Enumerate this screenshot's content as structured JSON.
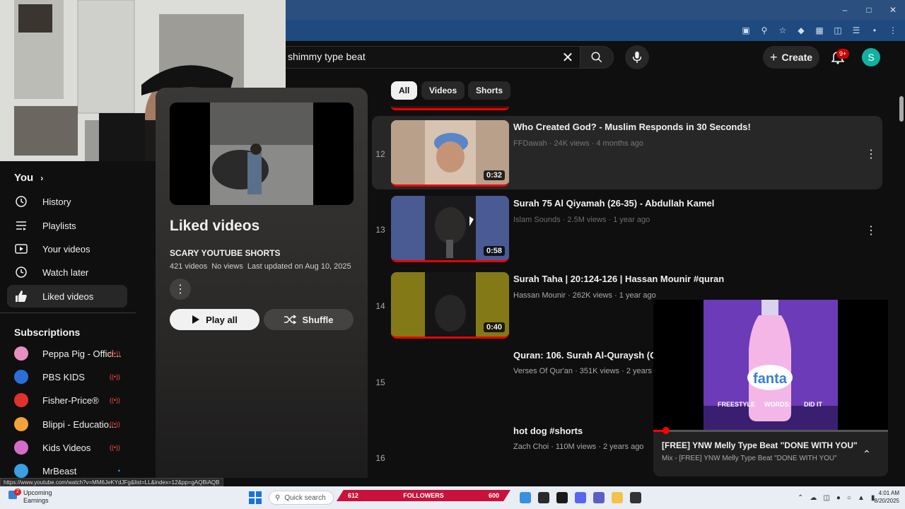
{
  "header": {
    "search_query": "shimmy type beat",
    "create_label": "Create",
    "notification_count": "9+",
    "avatar_letter": "S"
  },
  "sidebar": {
    "you_label": "You",
    "items": [
      {
        "label": "History",
        "icon": "history-icon"
      },
      {
        "label": "Playlists",
        "icon": "playlists-icon"
      },
      {
        "label": "Your videos",
        "icon": "your-videos-icon"
      },
      {
        "label": "Watch later",
        "icon": "watch-later-icon"
      },
      {
        "label": "Liked videos",
        "icon": "liked-icon"
      }
    ],
    "subscriptions_label": "Subscriptions",
    "subscriptions": [
      {
        "label": "Peppa Pig - Offici...",
        "color": "#e78fc0"
      },
      {
        "label": "PBS KIDS",
        "color": "#2a6fd6"
      },
      {
        "label": "Fisher-Price®",
        "color": "#e0322a"
      },
      {
        "label": "Blippi - Educatio...",
        "color": "#f2a23a"
      },
      {
        "label": "Kids Videos",
        "color": "#d56cc8"
      },
      {
        "label": "MrBeast",
        "color": "#3aa0e0"
      }
    ]
  },
  "playlist": {
    "title": "Liked videos",
    "owner": "SCARY YOUTUBE SHORTS",
    "count": "421 videos",
    "views": "No views",
    "updated": "Last updated on Aug 10, 2025",
    "play_all_label": "Play all",
    "shuffle_label": "Shuffle"
  },
  "chips": [
    "All",
    "Videos",
    "Shorts"
  ],
  "videos": [
    {
      "index": "12",
      "title": "Who Created God? - Muslim Responds in 30 Seconds!",
      "meta": "FFDawah · 24K views · 4 months ago",
      "duration": "0:32",
      "color": "#c0a48a"
    },
    {
      "index": "13",
      "title": "Surah 75 Al Qiyamah (26-35) - Abdullah Kamel",
      "meta": "Islam Sounds · 2.5M views · 1 year ago",
      "duration": "0:58",
      "color": "#3b4a80"
    },
    {
      "index": "14",
      "title": "Surah Taha | 20:124-126 | Hassan Mounir #quran",
      "meta": "Hassan Mounir · 262K views · 1 year ago",
      "duration": "0:40",
      "color": "#7a7314"
    },
    {
      "index": "15",
      "title": "Quran: 106. Surah Al-Quraysh (Qu",
      "meta": "Verses Of Qur'an · 351K views · 2 years ago",
      "duration": "",
      "color": "#0f0f0f"
    },
    {
      "index": "16",
      "title": "hot dog #shorts",
      "meta": "Zach Choi · 110M views · 2 years ago",
      "duration": "",
      "color": "#0f0f0f"
    }
  ],
  "miniplayer": {
    "title": "[FREE] YNW Melly Type Beat \"DONE WITH YOU\"",
    "subtitle": "Mix - [FREE] YNW Melly Type Beat \"DONE WITH YOU\"",
    "brand_text": "fanta",
    "caption_left": "FREESTYLE",
    "caption_mid": "WORDS:",
    "caption_right": "DID IT",
    "progress": 0.05
  },
  "status_url": "https://www.youtube.com/watch?v=MM6JeKYdJFg&list=LL&index=12&pp=gAQBiAQB",
  "taskbar": {
    "weather_title": "Upcoming",
    "weather_sub": "Earnings",
    "weather_badge": "2",
    "search_placeholder": "Quick search",
    "stream_left": "612",
    "stream_label": "FOLLOWERS",
    "stream_right": "600",
    "time": "4:01 AM",
    "date": "8/20/2025"
  }
}
